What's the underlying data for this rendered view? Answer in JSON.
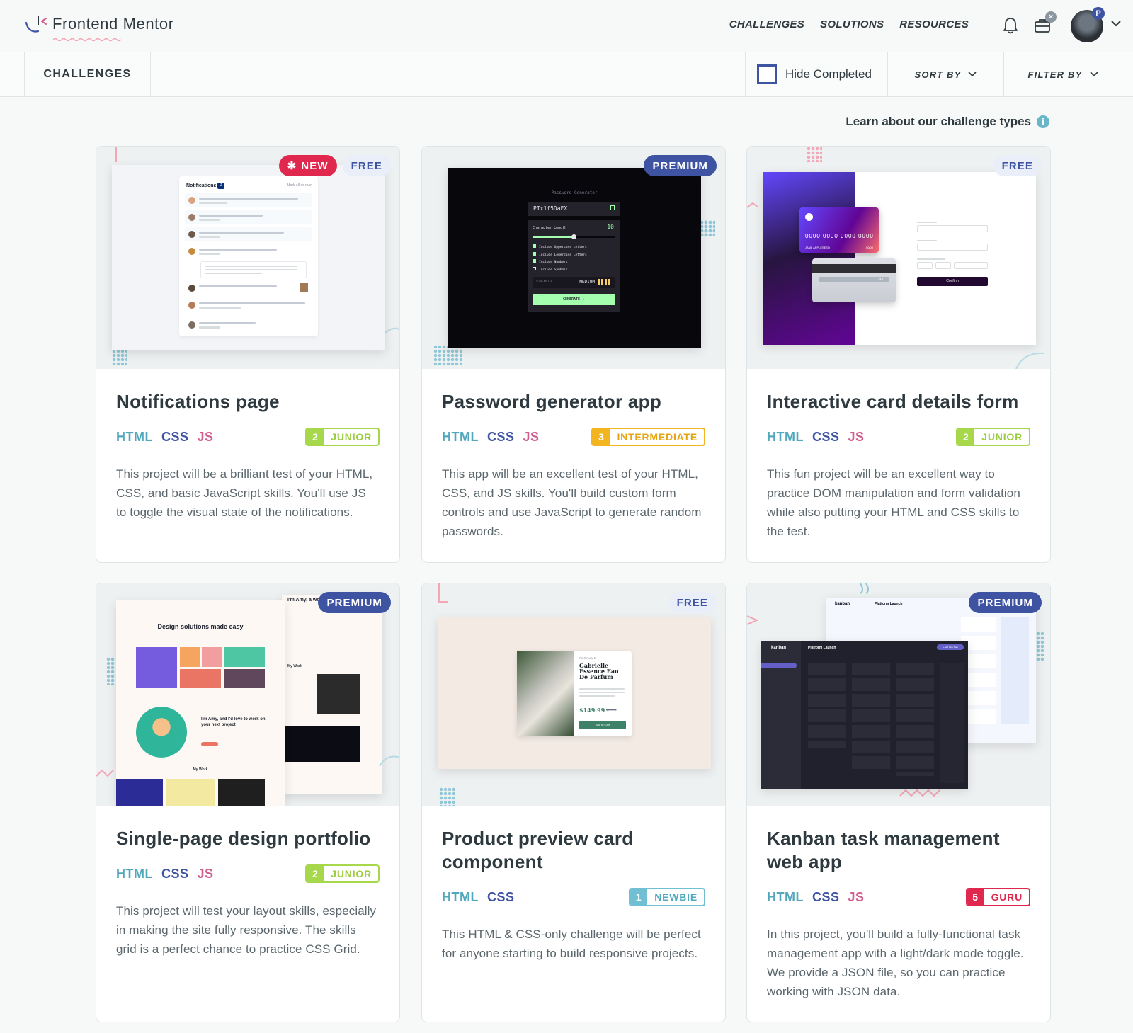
{
  "brand": {
    "name": "Frontend Mentor"
  },
  "nav": {
    "links": [
      "CHALLENGES",
      "SOLUTIONS",
      "RESOURCES"
    ],
    "avatar_badge": "P",
    "notif_badge": "×"
  },
  "subbar": {
    "title": "CHALLENGES",
    "hide_completed": "Hide Completed",
    "sort_by": "SORT BY",
    "filter_by": "FILTER BY"
  },
  "learn_link": "Learn about our challenge types",
  "colors": {
    "primary": "#3e54a3",
    "html": "#51a8bd",
    "css": "#3e54a3",
    "js": "#d15f8e",
    "new": "#e0284f"
  },
  "cards": [
    {
      "title": "Notifications page",
      "badges": [
        "NEW",
        "FREE"
      ],
      "langs": [
        "HTML",
        "CSS",
        "JS"
      ],
      "level_num": "2",
      "level": "JUNIOR",
      "desc": "This project will be a brilliant test of your HTML, CSS, and basic JavaScript skills. You'll use JS to toggle the visual state of the notifications.",
      "thumb": {
        "heading": "Notifications",
        "count": "3",
        "mark": "Mark all as read"
      }
    },
    {
      "title": "Password generator app",
      "badges": [
        "PREMIUM"
      ],
      "langs": [
        "HTML",
        "CSS",
        "JS"
      ],
      "level_num": "3",
      "level": "INTERMEDIATE",
      "desc": "This app will be an excellent test of your HTML, CSS, and JS skills. You'll build custom form controls and use JavaScript to generate random passwords.",
      "thumb": {
        "heading": "Password Generator",
        "password": "PTx1f5DaFX",
        "length_label": "Character Length",
        "length": "10",
        "options": [
          "Include Uppercase Letters",
          "Include Lowercase Letters",
          "Include Numbers",
          "Include Symbols"
        ],
        "strength_label": "STRENGTH",
        "strength": "MEDIUM",
        "button": "GENERATE →"
      }
    },
    {
      "title": "Interactive card details form",
      "badges": [
        "FREE"
      ],
      "langs": [
        "HTML",
        "CSS",
        "JS"
      ],
      "level_num": "2",
      "level": "JUNIOR",
      "desc": "This fun project will be an excellent way to practice DOM manipulation and form validation while also putting your HTML and CSS skills to the test.",
      "thumb": {
        "card_number": "0000 0000 0000 0000",
        "card_name": "JANE APPLESEED",
        "card_exp": "00/00",
        "cvc": "000",
        "button": "Confirm"
      }
    },
    {
      "title": "Single-page design portfolio",
      "badges": [
        "PREMIUM"
      ],
      "langs": [
        "HTML",
        "CSS",
        "JS"
      ],
      "level_num": "2",
      "level": "JUNIOR",
      "desc": "This project will test your layout skills, especially in making the site fully responsive. The skills grid is a perfect chance to practice CSS Grid.",
      "thumb": {
        "heading": "Design solutions made easy",
        "intro": "I'm Amy, and I'd love to work on your next project",
        "intro_side": "I'm Amy, a work on you",
        "work": "My Work"
      }
    },
    {
      "title": "Product preview card component",
      "badges": [
        "FREE"
      ],
      "langs": [
        "HTML",
        "CSS"
      ],
      "level_num": "1",
      "level": "NEWBIE",
      "desc": "This HTML & CSS-only challenge will be perfect for anyone starting to build responsive projects.",
      "thumb": {
        "category": "PERFUME",
        "product": "Gabrielle Essence Eau De Parfum",
        "price": "$149.99",
        "old_price": "$169.99",
        "button": "Add to Cart"
      }
    },
    {
      "title": "Kanban task management web app",
      "badges": [
        "PREMIUM"
      ],
      "langs": [
        "HTML",
        "CSS",
        "JS"
      ],
      "level_num": "5",
      "level": "GURU",
      "desc": "In this project, you'll build a fully-functional task management app with a light/dark mode toggle. We provide a JSON file, so you can practice working with JSON data.",
      "thumb": {
        "logo": "kanban",
        "board": "Platform Launch",
        "button": "+ Add New Task"
      }
    }
  ]
}
